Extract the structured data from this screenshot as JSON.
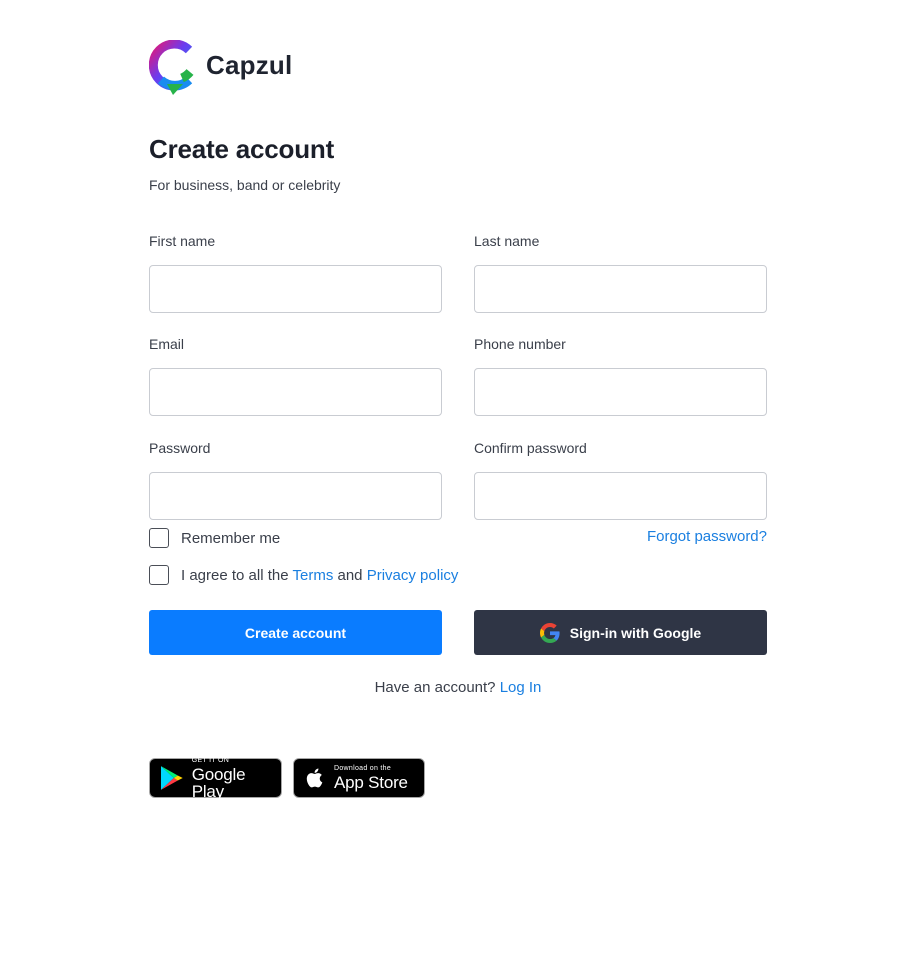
{
  "brand": {
    "name": "Capzul"
  },
  "heading": {
    "title": "Create account",
    "subtitle": "For business, band or celebrity"
  },
  "form": {
    "first_name": {
      "label": "First name",
      "value": "",
      "placeholder": ""
    },
    "last_name": {
      "label": "Last name",
      "value": "",
      "placeholder": ""
    },
    "email": {
      "label": "Email",
      "value": "",
      "placeholder": ""
    },
    "phone": {
      "label": "Phone number",
      "value": "",
      "placeholder": ""
    },
    "password": {
      "label": "Password",
      "value": "",
      "placeholder": ""
    },
    "confirm_password": {
      "label": "Confirm password",
      "value": "",
      "placeholder": ""
    },
    "remember_me": {
      "label": "Remember me",
      "checked": false
    },
    "forgot_password": "Forgot password?",
    "agree": {
      "prefix": "I agree to all the",
      "terms": "Terms",
      "and": "and",
      "privacy": "Privacy policy",
      "checked": false
    }
  },
  "actions": {
    "create_account": "Create account",
    "google_signin": "Sign-in with Google"
  },
  "footer": {
    "have_account": "Have an account?",
    "login": "Log In"
  },
  "stores": {
    "google_play": {
      "small": "GET IT ON",
      "big": "Google Play"
    },
    "app_store": {
      "small": "Download on the",
      "big": "App Store"
    }
  },
  "colors": {
    "primary": "#0a7cff",
    "link": "#1a7fe0",
    "google_button": "#2f3545",
    "text": "#1f2430"
  },
  "icons": [
    "capzul-logo-icon",
    "google-g-icon",
    "google-play-icon",
    "apple-icon"
  ]
}
